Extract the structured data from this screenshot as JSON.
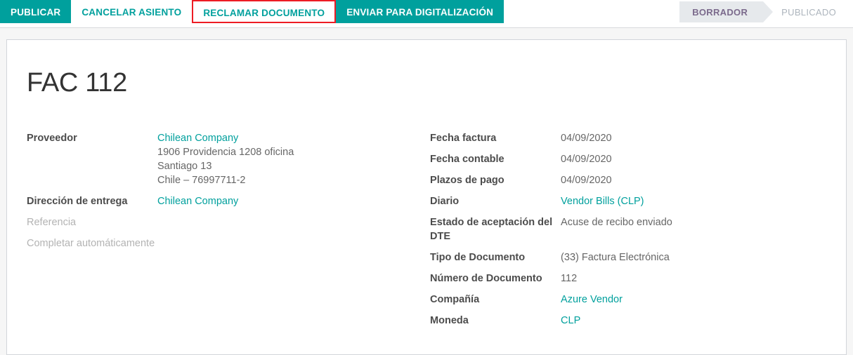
{
  "toolbar": {
    "buttons": [
      {
        "label": "PUBLICAR",
        "style": "primary"
      },
      {
        "label": "CANCELAR ASIENTO",
        "style": "link"
      },
      {
        "label": "RECLAMAR DOCUMENTO",
        "style": "outline-danger"
      },
      {
        "label": "ENVIAR PARA DIGITALIZACIÓN",
        "style": "primary"
      }
    ],
    "publish_label": "PUBLICAR",
    "cancel_entry_label": "CANCELAR ASIENTO",
    "claim_document_label": "RECLAMAR DOCUMENTO",
    "send_digitization_label": "ENVIAR PARA DIGITALIZACIÓN"
  },
  "status_ribbon": {
    "active_label": "BORRADOR",
    "inactive_label": "PUBLICADO"
  },
  "record": {
    "title": "FAC 112"
  },
  "left_fields": {
    "vendor": {
      "label": "Proveedor",
      "value": "Chilean Company",
      "address": [
        "1906 Providencia 1208 oficina",
        "Santiago 13",
        "Chile – 76997711-2"
      ]
    },
    "delivery_address": {
      "label": "Dirección de entrega",
      "value": "Chilean Company"
    },
    "reference": {
      "label": "Referencia",
      "value": ""
    },
    "autocomplete": {
      "label": "Completar automáticamente",
      "value": ""
    }
  },
  "right_fields": [
    {
      "label": "Fecha factura",
      "value": "04/09/2020",
      "link": false
    },
    {
      "label": "Fecha contable",
      "value": "04/09/2020",
      "link": false
    },
    {
      "label": "Plazos de pago",
      "value": "04/09/2020",
      "link": false
    },
    {
      "label": "Diario",
      "value": "Vendor Bills (CLP)",
      "link": true
    },
    {
      "label": "Estado de aceptación del DTE",
      "value": "Acuse de recibo enviado",
      "link": false
    },
    {
      "label": "Tipo de Documento",
      "value": "(33) Factura Electrónica",
      "link": false
    },
    {
      "label": "Número de Documento",
      "value": "112",
      "link": false
    },
    {
      "label": "Compañía",
      "value": "Azure Vendor",
      "link": true
    },
    {
      "label": "Moneda",
      "value": "CLP",
      "link": true
    }
  ],
  "colors": {
    "accent_teal": "#00a09d",
    "danger_red": "#ed1c24",
    "ribbon_active_bg": "#e6e9ec",
    "ribbon_active_text": "#7b6a8c",
    "ribbon_inactive_text": "#adb5bd",
    "label_text": "#4c4c4c",
    "value_text": "#666666",
    "muted_label": "#b3b3b3"
  }
}
